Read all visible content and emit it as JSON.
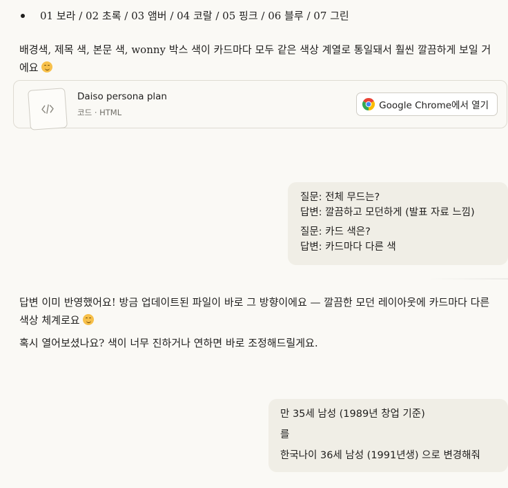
{
  "assistant_1": {
    "bullet_text": "01 보라 / 02 초록 / 03 앰버 / 04 코랄 / 05 핑크 / 06 블루 / 07 그린",
    "paragraph": "배경색, 제목 색, 본문 색, wonny 박스 색이 카드마다 모두 같은 색상 계열로 통일돼서 훨씬 깔끔하게 보일 거에요",
    "emoji_icon": "smiling-face-icon"
  },
  "artifact": {
    "title": "Daiso persona plan",
    "meta": "코드 · HTML",
    "thumb_icon": "code-brackets-icon",
    "open_label": "Google Chrome에서 열기",
    "open_icon": "chrome-icon"
  },
  "user_1": {
    "q1": "질문: 전체 무드는?",
    "a1": "답변: 깔끔하고 모던하게 (발표 자료 느낌)",
    "q2": "질문: 카드 색은?",
    "a2": "답변: 카드마다 다른 색"
  },
  "assistant_2": {
    "paragraph_1": "답변 이미 반영했어요! 방금 업데이트된 파일이 바로 그 방향이에요 — 깔끔한 모던 레이아웃에 카드마다 다른 색상 체계로요",
    "paragraph_2": "혹시 열어보셨나요? 색이 너무 진하거나 연하면 바로 조정해드릴게요."
  },
  "user_2": {
    "line_1": "만 35세 남성 (1989년 창업 기준)",
    "line_2": "를",
    "line_3": "한국나이 36세 남성 (1991년생) 으로 변경해줘"
  },
  "colors": {
    "page_bg": "#faf9f5",
    "user_bubble_bg": "#f0eee6",
    "text": "#1f1e1d",
    "muted_text": "#6f6d66",
    "border": "#dedbd2"
  }
}
